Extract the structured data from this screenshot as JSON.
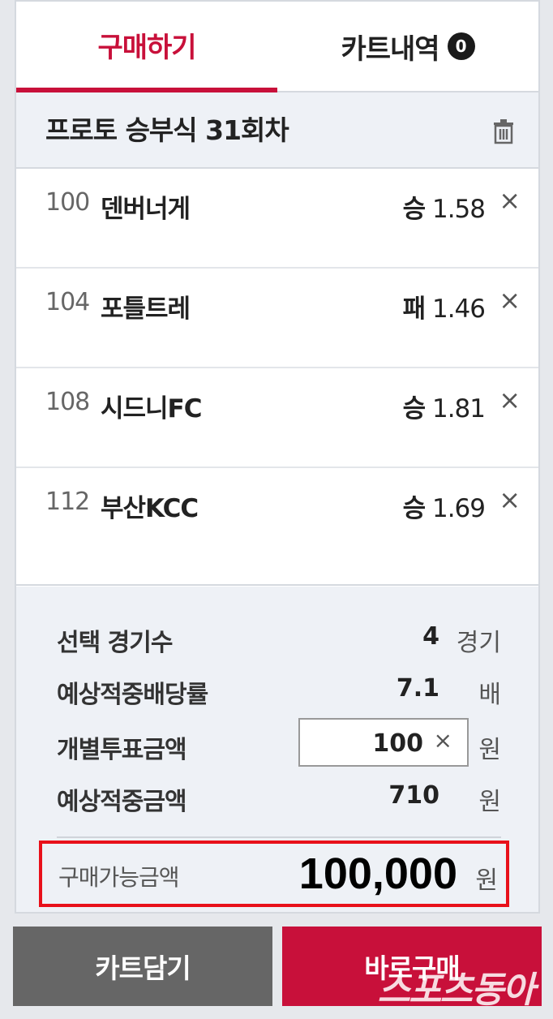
{
  "tabs": {
    "buy_label": "구매하기",
    "cart_label": "카트내역",
    "cart_count": "0"
  },
  "round": {
    "title": "프로토 승부식 31회차",
    "delete_icon": "trash-icon"
  },
  "picks": [
    {
      "no": "100",
      "team": "덴버너게",
      "result": "승",
      "odds": "1.58"
    },
    {
      "no": "104",
      "team": "포틀트레",
      "result": "패",
      "odds": "1.46"
    },
    {
      "no": "108",
      "team": "시드니FC",
      "result": "승",
      "odds": "1.81"
    },
    {
      "no": "112",
      "team": "부산KCC",
      "result": "승",
      "odds": "1.69"
    }
  ],
  "remove_glyph": "×",
  "summary": {
    "games_label": "선택 경기수",
    "games_value": "4",
    "games_unit": "경기",
    "odds_label": "예상적중배당률",
    "odds_value": "7.1",
    "odds_unit": "배",
    "stake_label": "개별투표금액",
    "stake_value": "100",
    "stake_unit": "원",
    "payout_label": "예상적중금액",
    "payout_value": "710",
    "payout_unit": "원",
    "available_label": "구매가능금액",
    "available_value": "100,000",
    "available_unit": "원"
  },
  "buttons": {
    "add_cart": "카트담기",
    "buy_now": "바로구매"
  },
  "watermark": "스포츠동아",
  "colors": {
    "accent": "#c8103a",
    "highlight_border": "#e8101a",
    "cart_button": "#666666"
  }
}
